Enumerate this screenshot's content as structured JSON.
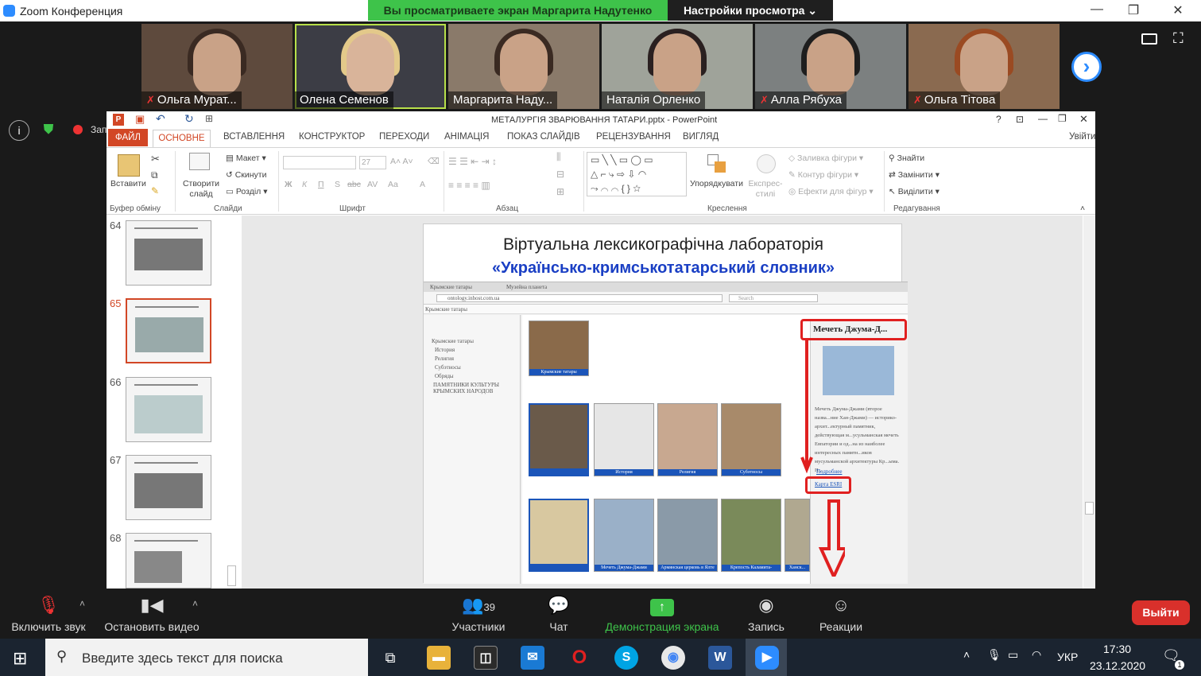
{
  "zoom": {
    "window_title": "Zoom Конференция",
    "share_banner": "Вы просматриваете экран Маргарита Надутенко",
    "view_options": "Настройки просмотра ⌄",
    "recording_label": "Запись",
    "participants": [
      {
        "name": "Ольга Мурат...",
        "muted": true
      },
      {
        "name": "Олена Семенов",
        "muted": false
      },
      {
        "name": "Маргарита Наду...",
        "muted": false
      },
      {
        "name": "Наталія Орленко",
        "muted": false
      },
      {
        "name": "Алла Рябуха",
        "muted": true
      },
      {
        "name": "Ольга Тітова",
        "muted": true
      }
    ],
    "bottom": {
      "mute": "Включить звук",
      "video": "Остановить видео",
      "participants": "Участники",
      "participants_count": "39",
      "chat": "Чат",
      "share": "Демонстрация экрана",
      "record": "Запись",
      "reactions": "Реакции",
      "leave": "Выйти"
    },
    "accent": "#2d8cff",
    "share_green": "#3ec34a",
    "leave_red": "#d9302b"
  },
  "ppt": {
    "title": "МЕТАЛУРГІЯ ЗВАРЮВАННЯ ТАТАРИ.pptx - PowerPoint",
    "signin": "Увійти",
    "tabs": [
      "ФАЙЛ",
      "ОСНОВНЕ",
      "ВСТАВЛЕННЯ",
      "КОНСТРУКТОР",
      "ПЕРЕХОДИ",
      "АНІМАЦІЯ",
      "ПОКАЗ СЛАЙДІВ",
      "РЕЦЕНЗУВАННЯ",
      "ВИГЛЯД"
    ],
    "ribbon": {
      "paste": "Вставити",
      "clipboard": "Буфер обміну",
      "new_slide": "Створити слайд",
      "layout": "Макет",
      "reset": "Скинути",
      "section": "Розділ",
      "slides": "Слайди",
      "font_size": "27",
      "font": "Шрифт",
      "paragraph": "Абзац",
      "arrange": "Упорядкувати",
      "quick_styles": "Експрес-стилі",
      "shape_fill": "Заливка фігури",
      "shape_outline": "Контур фігури",
      "shape_effects": "Ефекти для фігур",
      "drawing": "Креслення",
      "find": "Знайти",
      "replace": "Замінити",
      "select": "Виділити",
      "editing": "Редагування"
    },
    "slide_numbers": [
      "64",
      "65",
      "66",
      "67",
      "68"
    ],
    "selected_slide": "65",
    "slide": {
      "title_line1": "Віртуальна лексикографічна лабораторія",
      "title_line2": "«Українсько-кримськотатарський словник»"
    },
    "inner": {
      "tab1": "Крымские татары",
      "tab2": "Музейна планета",
      "url": "ontology.inhost.com.ua",
      "search_placeholder": "Search",
      "toolbar_label": "Крымские татары",
      "tree": [
        "Крымские татары",
        "История",
        "Религия",
        "Субэтносы",
        "Обряды",
        "ПАМЯТНИКИ КУЛЬТУРЫ КРЫМСКИХ НАРОДОВ"
      ],
      "row1_caps": [
        "Крымские татары"
      ],
      "row2_caps": [
        "",
        "История",
        "Религия",
        "Субэтносы"
      ],
      "row3_caps": [
        "",
        "Мечеть Джума-Джами",
        "Армянская церковь в Ялте",
        "Крепость Каламита-Инкерман",
        "Ханск..."
      ],
      "panel_title": "Мечеть Джума-Д...",
      "panel_text": "Мечеть Джума-Джами (второе назва...ние Хан-Джами) — историко-архит...ектурный памятник, действующая м...усульманская мечеть Евпатории и од...на из наиболее интересных памятн...иков мусульманской архитектуры Кр...ыма. П...",
      "panel_more": "Подробнее",
      "panel_map": "Карта ESRI"
    }
  },
  "taskbar": {
    "search_placeholder": "Введите здесь текст для поиска",
    "language": "УКР",
    "time": "17:30",
    "date": "23.12.2020",
    "notification_count": "1"
  }
}
